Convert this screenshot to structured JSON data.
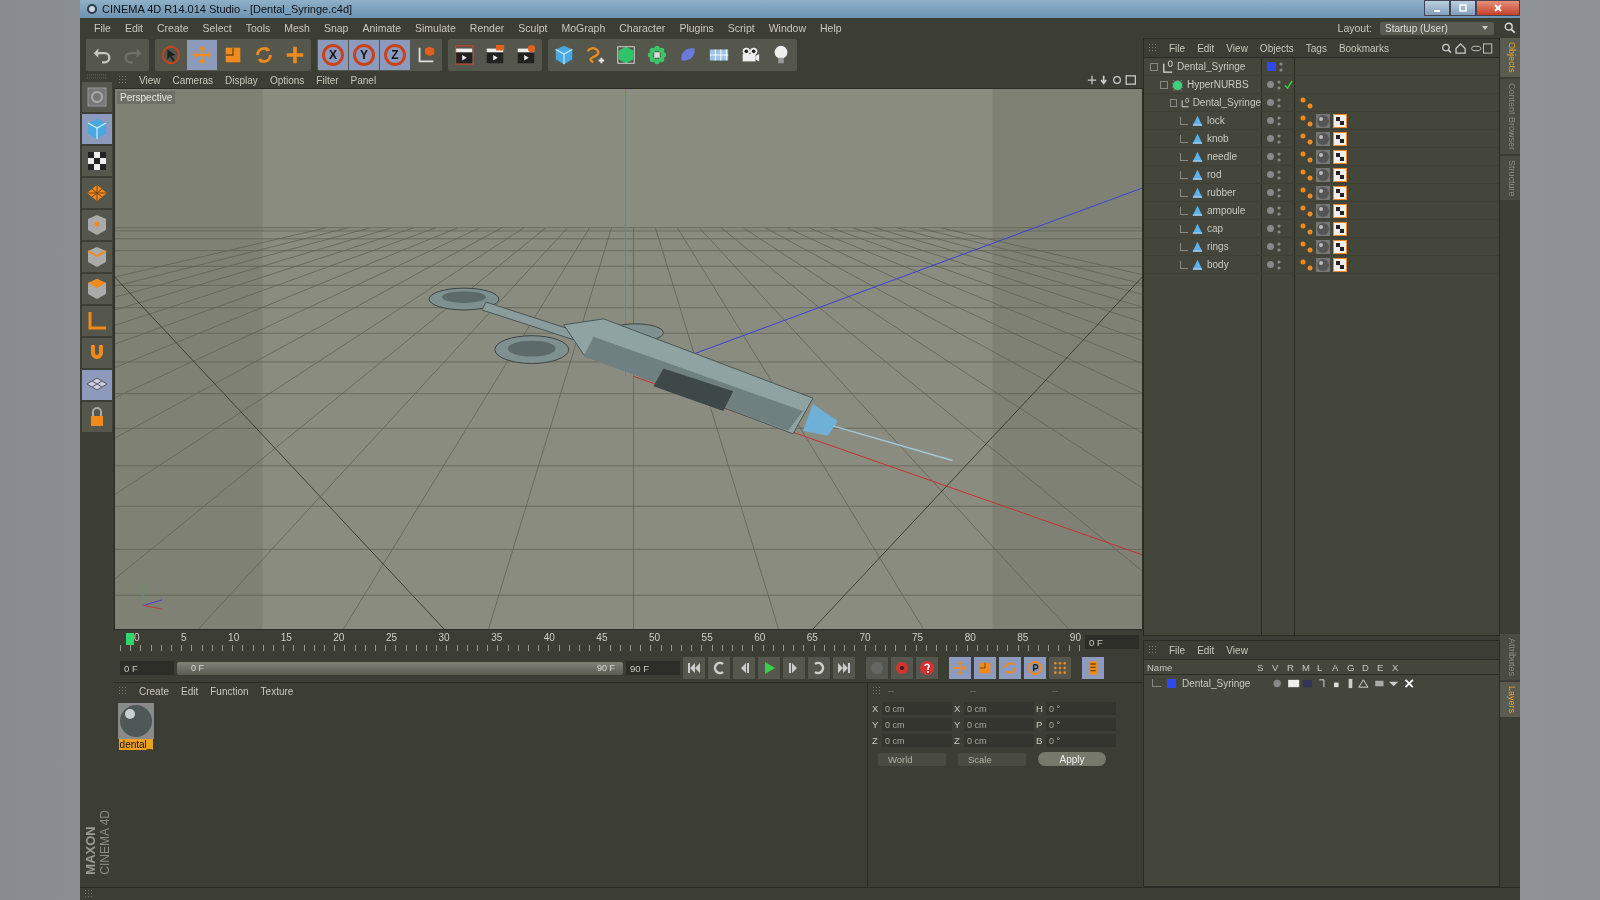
{
  "window": {
    "title": "CINEMA 4D R14.014 Studio - [Dental_Syringe.c4d]"
  },
  "menu": [
    "File",
    "Edit",
    "Create",
    "Select",
    "Tools",
    "Mesh",
    "Snap",
    "Animate",
    "Simulate",
    "Render",
    "Sculpt",
    "MoGraph",
    "Character",
    "Plugins",
    "Script",
    "Window",
    "Help"
  ],
  "layout": {
    "label": "Layout:",
    "value": "Startup (User)"
  },
  "toolbar": [
    [
      {
        "kind": "undo",
        "selected": false
      },
      {
        "kind": "redo",
        "selected": false
      }
    ],
    [
      {
        "kind": "cursor",
        "selected": false
      },
      {
        "kind": "move",
        "selected": true
      },
      {
        "kind": "scale",
        "selected": false
      },
      {
        "kind": "rotate",
        "selected": false
      },
      {
        "kind": "plus",
        "selected": false
      }
    ],
    [
      {
        "kind": "axis",
        "label": "X",
        "selected": true
      },
      {
        "kind": "axis",
        "label": "Y",
        "selected": true
      },
      {
        "kind": "axis",
        "label": "Z",
        "selected": true
      },
      {
        "kind": "coords",
        "selected": false
      }
    ],
    [
      {
        "kind": "render-view",
        "selected": false
      },
      {
        "kind": "render-picture",
        "selected": false
      },
      {
        "kind": "render-settings",
        "selected": false
      }
    ],
    [
      {
        "kind": "cube",
        "selected": false
      },
      {
        "kind": "spline",
        "selected": false
      },
      {
        "kind": "nurbs",
        "selected": false
      },
      {
        "kind": "array",
        "selected": false
      },
      {
        "kind": "deformer",
        "selected": false
      },
      {
        "kind": "floor",
        "selected": false
      },
      {
        "kind": "camera",
        "selected": false
      },
      {
        "kind": "light",
        "selected": false
      }
    ]
  ],
  "tools": [
    {
      "kind": "model",
      "selected": false
    },
    {
      "kind": "cube",
      "selected": true
    },
    {
      "kind": "checker",
      "selected": false
    },
    {
      "kind": "plane",
      "selected": false
    },
    {
      "kind": "points",
      "selected": false
    },
    {
      "kind": "edges",
      "selected": false
    },
    {
      "kind": "polygons",
      "selected": false
    },
    {
      "kind": "axis",
      "selected": false
    },
    {
      "kind": "magnet",
      "selected": false
    },
    {
      "kind": "workplane",
      "selected": true
    },
    {
      "kind": "lock",
      "selected": false
    }
  ],
  "brand": [
    "MAXON",
    "CINEMA 4D"
  ],
  "viewport": {
    "menu": [
      "View",
      "Cameras",
      "Display",
      "Options",
      "Filter",
      "Panel"
    ],
    "label": "Perspective"
  },
  "timeline": {
    "ticks": [
      "0",
      "5",
      "10",
      "15",
      "20",
      "25",
      "30",
      "35",
      "40",
      "45",
      "50",
      "55",
      "60",
      "65",
      "70",
      "75",
      "80",
      "85",
      "90"
    ],
    "level": 0,
    "current_frame": "0 F",
    "start": "0 F",
    "preview_range": {
      "start": "0 F",
      "end": "90 F",
      "level": 1
    },
    "end": "90 F"
  },
  "materials": {
    "menu": [
      "Create",
      "Edit",
      "Function",
      "Texture"
    ],
    "items": [
      {
        "name": "dental_",
        "selected": true
      }
    ]
  },
  "coordinates": {
    "headers": [
      "--",
      "--",
      "--"
    ],
    "disabled": true,
    "rows": [
      {
        "axis": "X",
        "position": "0 cm",
        "size_axis": "X",
        "size": "0 cm",
        "rot_axis": "H",
        "rotation": "0 °"
      },
      {
        "axis": "Y",
        "position": "0 cm",
        "size_axis": "Y",
        "size": "0 cm",
        "rot_axis": "P",
        "rotation": "0 °"
      },
      {
        "axis": "Z",
        "position": "0 cm",
        "size_axis": "Z",
        "size": "0 cm",
        "rot_axis": "B",
        "rotation": "0 °"
      }
    ],
    "mode": "World",
    "size_mode": "Scale",
    "button": "Apply"
  },
  "objects": {
    "menu": [
      "File",
      "Edit",
      "View",
      "Objects",
      "Tags",
      "Bookmarks"
    ],
    "tree": [
      {
        "name": "Dental_Syringe",
        "kind": "null",
        "color": "#2f48f0",
        "children": [
          {
            "name": "HyperNURBS",
            "kind": "nurbs",
            "enabled": true,
            "children": [
              {
                "name": "Dental_Syringe",
                "kind": "null",
                "tags": [
                  {
                    "kind": "phong"
                  }
                ],
                "children": [
                  {
                    "name": "lock",
                    "kind": "polygon",
                    "tags": [
                      {
                        "kind": "phong"
                      },
                      {
                        "kind": "material"
                      },
                      {
                        "kind": "texture"
                      }
                    ]
                  },
                  {
                    "name": "knob",
                    "kind": "polygon",
                    "tags": [
                      {
                        "kind": "phong"
                      },
                      {
                        "kind": "material"
                      },
                      {
                        "kind": "texture"
                      }
                    ]
                  },
                  {
                    "name": "needle",
                    "kind": "polygon",
                    "tags": [
                      {
                        "kind": "phong"
                      },
                      {
                        "kind": "material"
                      },
                      {
                        "kind": "texture"
                      }
                    ]
                  },
                  {
                    "name": "rod",
                    "kind": "polygon",
                    "tags": [
                      {
                        "kind": "phong"
                      },
                      {
                        "kind": "material"
                      },
                      {
                        "kind": "texture"
                      }
                    ]
                  },
                  {
                    "name": "rubber",
                    "kind": "polygon",
                    "tags": [
                      {
                        "kind": "phong"
                      },
                      {
                        "kind": "material"
                      },
                      {
                        "kind": "texture"
                      }
                    ]
                  },
                  {
                    "name": "ampoule",
                    "kind": "polygon",
                    "tags": [
                      {
                        "kind": "phong"
                      },
                      {
                        "kind": "material"
                      },
                      {
                        "kind": "texture"
                      }
                    ]
                  },
                  {
                    "name": "cap",
                    "kind": "polygon",
                    "tags": [
                      {
                        "kind": "phong"
                      },
                      {
                        "kind": "material"
                      },
                      {
                        "kind": "texture"
                      }
                    ]
                  },
                  {
                    "name": "rings",
                    "kind": "polygon",
                    "tags": [
                      {
                        "kind": "phong"
                      },
                      {
                        "kind": "material"
                      },
                      {
                        "kind": "texture"
                      }
                    ]
                  },
                  {
                    "name": "body",
                    "kind": "polygon",
                    "tags": [
                      {
                        "kind": "phong"
                      },
                      {
                        "kind": "material"
                      },
                      {
                        "kind": "texture"
                      }
                    ]
                  }
                ]
              }
            ]
          }
        ]
      }
    ]
  },
  "side_tabs": [
    {
      "label": "Objects",
      "selected": true
    },
    {
      "label": "Content Browser",
      "selected": false
    },
    {
      "label": "Structure",
      "selected": false
    }
  ],
  "layers": {
    "menu": [
      "File",
      "Edit",
      "View"
    ],
    "columns": [
      "Name",
      "S",
      "V",
      "R",
      "M",
      "L",
      "A",
      "G",
      "D",
      "E",
      "X"
    ],
    "rows": [
      {
        "name": "Dental_Syringe",
        "color": "#2f48f0"
      }
    ]
  },
  "lower_tabs": [
    {
      "label": "Attributes",
      "selected": false
    },
    {
      "label": "Layers",
      "selected": true
    }
  ]
}
